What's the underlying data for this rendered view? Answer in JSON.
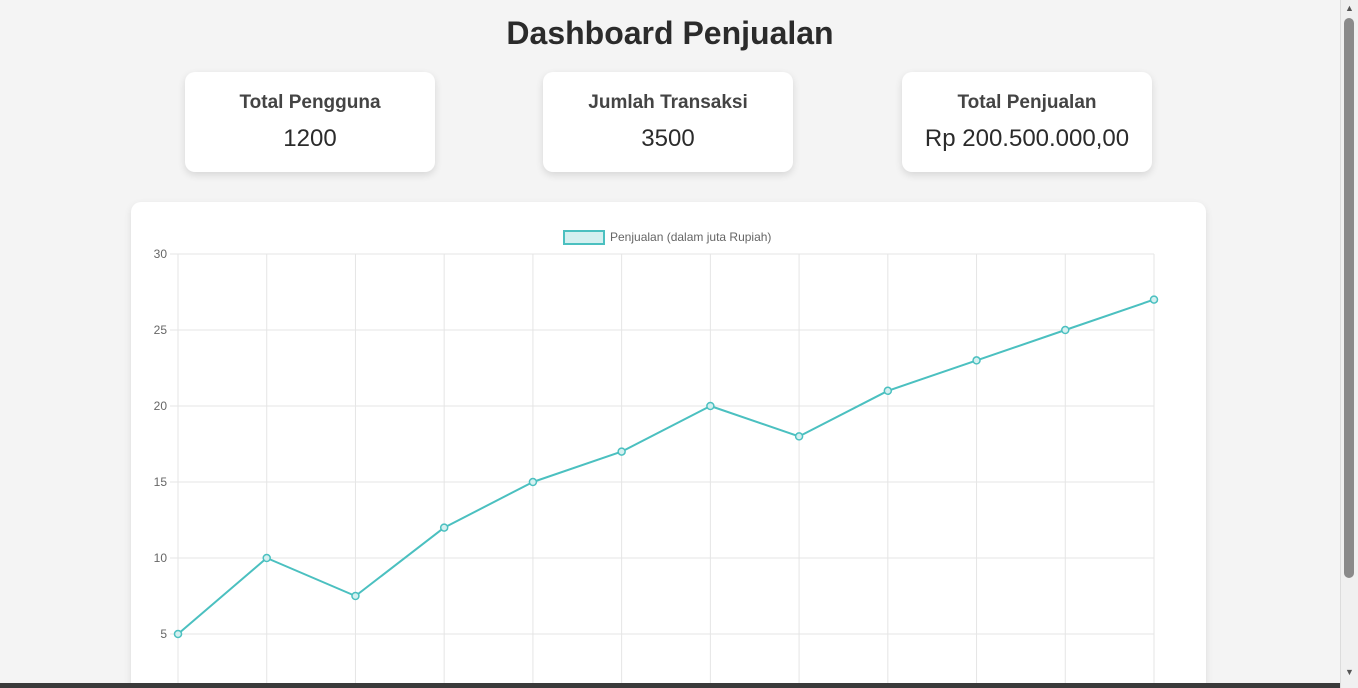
{
  "page": {
    "title": "Dashboard Penjualan"
  },
  "stats": [
    {
      "label": "Total Pengguna",
      "value": "1200"
    },
    {
      "label": "Jumlah Transaksi",
      "value": "3500"
    },
    {
      "label": "Total Penjualan",
      "value": "Rp 200.500.000,00"
    }
  ],
  "chart_data": {
    "type": "line",
    "series": [
      {
        "name": "Penjualan (dalam juta Rupiah)",
        "values": [
          5,
          10,
          7.5,
          12,
          15,
          17,
          20,
          18,
          21,
          23,
          25,
          27
        ],
        "color": "#4bc0c0",
        "fill": "#d4f0f0"
      }
    ],
    "ylim": [
      0,
      30
    ],
    "yticks": [
      5,
      10,
      15,
      20,
      25,
      30
    ],
    "grid": true,
    "legend": "top"
  },
  "colors": {
    "line": "#4bc0c0",
    "grid": "#e5e5e5",
    "background": "#f4f4f4"
  }
}
